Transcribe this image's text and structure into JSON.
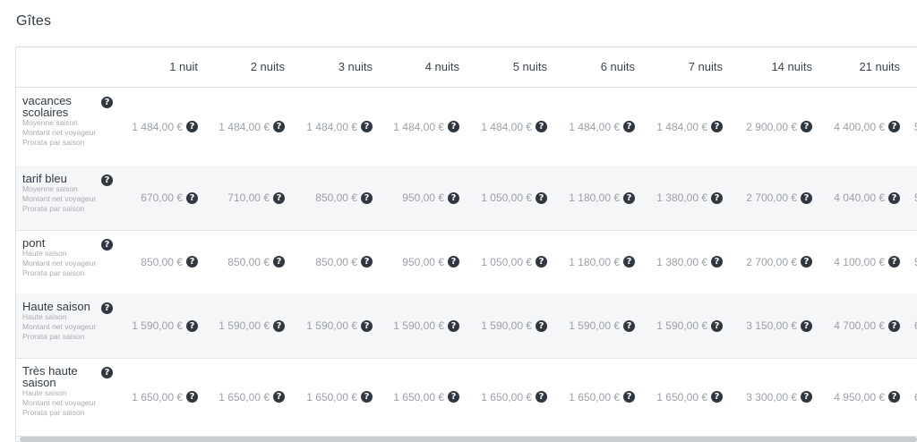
{
  "page": {
    "title": "Gîtes"
  },
  "table": {
    "columns": [
      "1 nuit",
      "2 nuits",
      "3 nuits",
      "4 nuits",
      "5 nuits",
      "6 nuits",
      "7 nuits",
      "14 nuits",
      "21 nuits"
    ],
    "rows": [
      {
        "name_lines": [
          "vacances",
          "scolaires"
        ],
        "meta": [
          "Moyenne saison",
          "Montant net voyageur",
          "Prorata par saison"
        ],
        "prices": [
          "1 484,00 €",
          "1 484,00 €",
          "1 484,00 €",
          "1 484,00 €",
          "1 484,00 €",
          "1 484,00 €",
          "1 484,00 €",
          "2 900,00 €",
          "4 400,00 €",
          "5"
        ]
      },
      {
        "name_lines": [
          "tarif bleu"
        ],
        "meta": [
          "Moyenne saison",
          "Montant net voyageur",
          "Prorata par saison"
        ],
        "prices": [
          "670,00 €",
          "710,00 €",
          "850,00 €",
          "950,00 €",
          "1 050,00 €",
          "1 180,00 €",
          "1 380,00 €",
          "2 700,00 €",
          "4 040,00 €",
          "5"
        ]
      },
      {
        "name_lines": [
          "pont"
        ],
        "meta": [
          "Haute saison",
          "Montant net voyageur",
          "Prorata par saison"
        ],
        "prices": [
          "850,00 €",
          "850,00 €",
          "850,00 €",
          "950,00 €",
          "1 050,00 €",
          "1 180,00 €",
          "1 380,00 €",
          "2 700,00 €",
          "4 100,00 €",
          "5"
        ]
      },
      {
        "name_lines": [
          "Haute saison"
        ],
        "meta": [
          "Haute saison",
          "Montant net voyageur",
          "Prorata par saison"
        ],
        "prices": [
          "1 590,00 €",
          "1 590,00 €",
          "1 590,00 €",
          "1 590,00 €",
          "1 590,00 €",
          "1 590,00 €",
          "1 590,00 €",
          "3 150,00 €",
          "4 700,00 €",
          "6"
        ]
      },
      {
        "name_lines": [
          "Très haute",
          "saison"
        ],
        "meta": [
          "Haute saison",
          "Montant net voyageur",
          "Prorata par saison"
        ],
        "prices": [
          "1 650,00 €",
          "1 650,00 €",
          "1 650,00 €",
          "1 650,00 €",
          "1 650,00 €",
          "1 650,00 €",
          "1 650,00 €",
          "3 300,00 €",
          "4 950,00 €",
          "6"
        ]
      }
    ]
  },
  "icons": {
    "help": "question-circle-icon"
  },
  "colors": {
    "help_icon_bg": "#2f3740",
    "row_alt_bg": "#f5f6f7",
    "meta_text": "#a8adb2"
  }
}
